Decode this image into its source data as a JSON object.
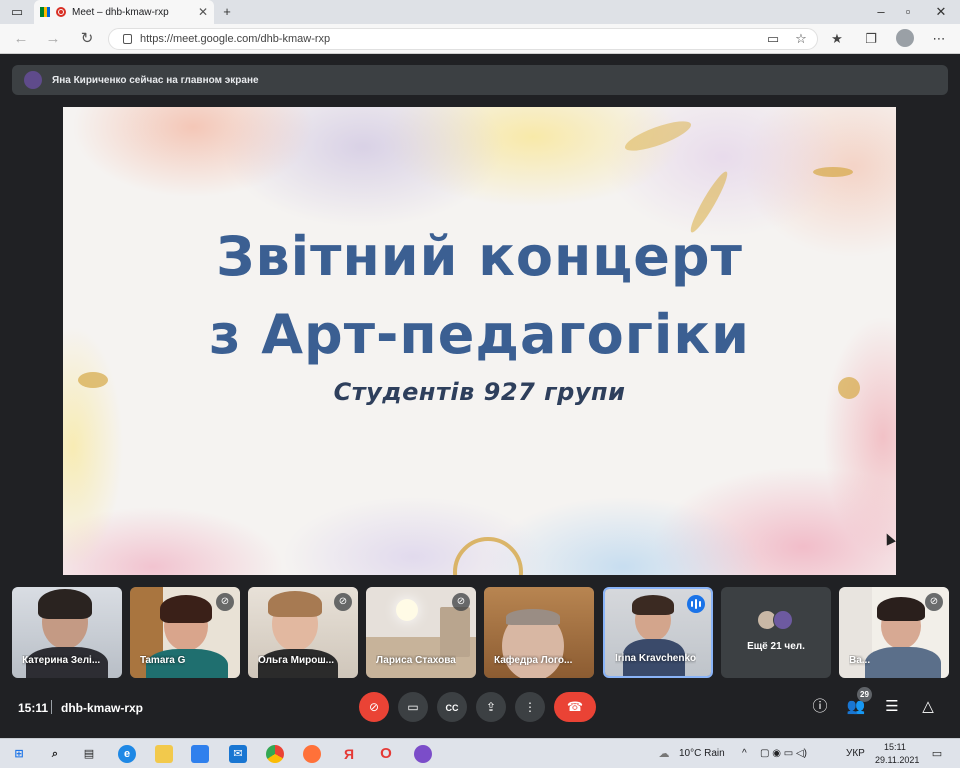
{
  "browser": {
    "tab_title": "Meet – dhb-kmaw-rxp",
    "url": "https://meet.google.com/dhb-kmaw-rxp",
    "new_tab_label": "+"
  },
  "banner": {
    "text": "Яна Кириченко сейчас на главном экране"
  },
  "slide": {
    "line1": "Звітний концерт",
    "line2": "з Арт-педагогіки",
    "line3": "Студентів 927 групи"
  },
  "participants": [
    {
      "name": "Катерина Зелі..."
    },
    {
      "name": "Tamara G"
    },
    {
      "name": "Ольга Мирош..."
    },
    {
      "name": "Лариса Стахова"
    },
    {
      "name": "Кафедра Лого..."
    },
    {
      "name": "Irina Kravchenko"
    },
    {
      "name": "Ещё 21 чел."
    },
    {
      "name": "Ва..."
    }
  ],
  "controls": {
    "time": "15:11",
    "meeting_code": "dhb-kmaw-rxp",
    "people_count": "29"
  },
  "taskbar": {
    "weather": "10°C  Rain",
    "lang": "УКР",
    "time": "15:11",
    "date": "29.11.2021"
  },
  "colors": {
    "meet_bg": "#202124",
    "end_call": "#ea4335",
    "active_speaker": "#1a73e8",
    "slide_title": "#3b5f92"
  }
}
